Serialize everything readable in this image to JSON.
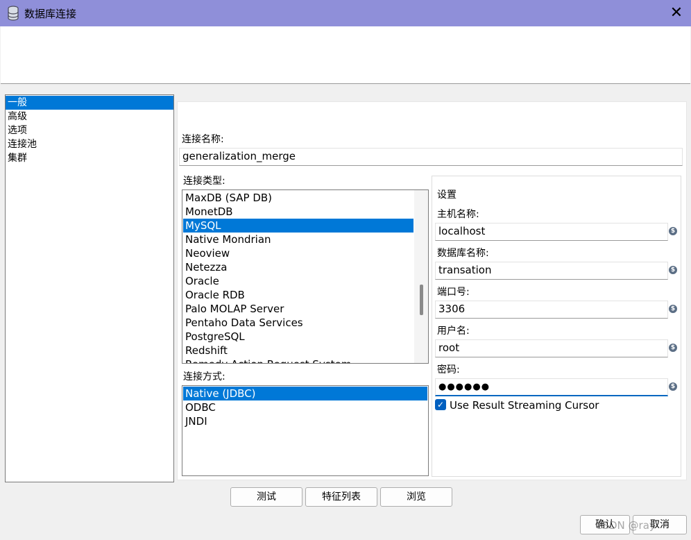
{
  "window": {
    "title": "数据库连接",
    "icon": "database-icon",
    "close_glyph": "✕"
  },
  "nav": {
    "items": [
      "一般",
      "高级",
      "选项",
      "连接池",
      "集群"
    ],
    "selected_index": 0
  },
  "connection_name": {
    "label": "连接名称:",
    "value": "generalization_merge"
  },
  "connection_type": {
    "label": "连接类型:",
    "items": [
      "MaxDB (SAP DB)",
      "MonetDB",
      "MySQL",
      "Native Mondrian",
      "Neoview",
      "Netezza",
      "Oracle",
      "Oracle RDB",
      "Palo MOLAP Server",
      "Pentaho Data Services",
      "PostgreSQL",
      "Redshift",
      "Remedy Action Request System"
    ],
    "selected": "MySQL"
  },
  "access": {
    "label": "连接方式:",
    "items": [
      "Native (JDBC)",
      "ODBC",
      "JNDI"
    ],
    "selected": "Native (JDBC)"
  },
  "settings": {
    "title": "设置",
    "host_label": "主机名称:",
    "host_value": "localhost",
    "db_label": "数据库名称:",
    "db_value": "transation",
    "port_label": "端口号:",
    "port_value": "3306",
    "user_label": "用户名:",
    "user_value": "root",
    "password_label": "密码:",
    "password_value": "●●●●●●",
    "streaming_label": "Use Result Streaming Cursor",
    "streaming_checked": true,
    "variable_icon": "$"
  },
  "buttons": {
    "test": "测试",
    "features": "特征列表",
    "explore": "浏览",
    "ok": "确认",
    "cancel": "取消"
  },
  "watermark": "CSDN @ray"
}
